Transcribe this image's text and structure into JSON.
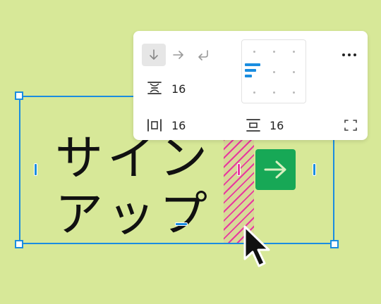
{
  "canvas": {
    "frame_text_line1": "サイン",
    "frame_text_line2": "アップ"
  },
  "panel": {
    "directions": [
      {
        "icon": "arrow-down-icon",
        "active": true
      },
      {
        "icon": "arrow-right-icon",
        "active": false
      },
      {
        "icon": "wrap-icon",
        "active": false
      }
    ],
    "spacing_between": "16",
    "padding_horizontal": "16",
    "padding_vertical": "16",
    "alignment": "top-left"
  },
  "colors": {
    "canvas_bg": "#d7e898",
    "selection_blue": "#1a8de0",
    "gap_pink": "#e8389e",
    "button_green": "#17a856"
  }
}
